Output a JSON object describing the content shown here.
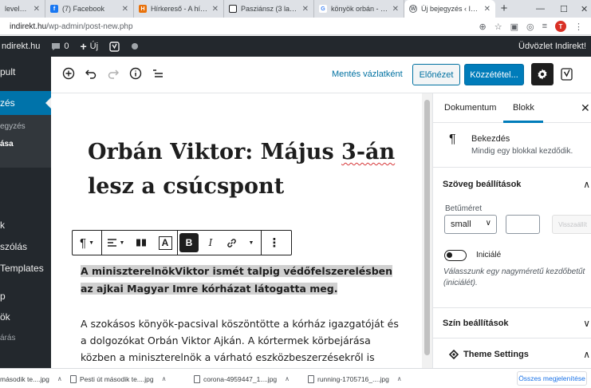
{
  "browser": {
    "tabs": [
      {
        "title": "levelek (64",
        "favicon_color": "#ea4335",
        "favicon": "M"
      },
      {
        "title": "(7) Facebook",
        "favicon_color": "#1877f2",
        "favicon": "f"
      },
      {
        "title": "Hírkereső - A hírek i",
        "favicon_color": "#e8710a",
        "favicon": "H"
      },
      {
        "title": "Pasziánsz (3 lap) - Pa",
        "favicon_color": "#202124",
        "favicon": "P"
      },
      {
        "title": "könyök orbán - Goog",
        "favicon_color": "#4285f4",
        "favicon": "G"
      },
      {
        "title": "Új bejegyzés ‹ Indire",
        "favicon_color": "#5f6368",
        "favicon": "W"
      }
    ],
    "url_host": "indirekt.hu",
    "url_path": "/wp-admin/post-new.php"
  },
  "adminbar": {
    "site": "ndirekt.hu",
    "comments": "0",
    "new_label": "Új",
    "greeting": "Üdvözlet Indirekt!"
  },
  "sidebar": {
    "items": [
      {
        "label": "pult"
      },
      {
        "label": "zés"
      },
      {
        "label": "egyzés"
      },
      {
        "label": "ása"
      },
      {
        "label": "k"
      },
      {
        "label": "szólás"
      },
      {
        "label": "Templates"
      },
      {
        "label": "p"
      },
      {
        "label": "ök"
      },
      {
        "label": "árás"
      }
    ]
  },
  "header": {
    "save_draft": "Mentés vázlatként",
    "preview": "Előnézet",
    "publish": "Közzététel..."
  },
  "post": {
    "title_1": "Orbán Viktor: Május ",
    "title_spell": "3-án",
    "title_2": "lesz a csúcspont",
    "selected_paragraph": "A miniszterelnökViktor ismét talpig védőfelszerelésben az ajkai Magyar Imre kórházat látogatta meg.",
    "body_paragraph": "A szokásos könyök-pacsival köszöntötte a kórház igazgatóját és a dolgozókat Orbán Viktor Ajkán. A kórtermek körbejárása közben a miniszterelnök a várható eszközbeszerzésekről is beszélt: „Én"
  },
  "panel": {
    "tab_document": "Dokumentum",
    "tab_block": "Blokk",
    "block_name": "Bekezdés",
    "block_desc": "Mindig egy blokkal kezdődik.",
    "text_settings": "Szöveg beállítások",
    "font_size_label": "Betűméret",
    "font_size_value": "small",
    "reset_label": "Visszaállít",
    "dropcap_label": "Iniciálé",
    "dropcap_help": "Válasszunk egy nagyméretű kezdőbetűt (iniciálét).",
    "color_settings": "Szín beállítások",
    "theme_settings": "Theme Settings"
  },
  "downloads": {
    "items": [
      {
        "name": "második te....jpg"
      },
      {
        "name": "Pesti út második te....jpg"
      },
      {
        "name": "corona-4959447_1....jpg"
      },
      {
        "name": "running-1705716_....jpg"
      }
    ],
    "show_all": "Összes megjelenítése"
  },
  "colors": {
    "wp_dark": "#23282d",
    "wp_blue": "#0073aa",
    "publish_blue": "#007cba"
  }
}
